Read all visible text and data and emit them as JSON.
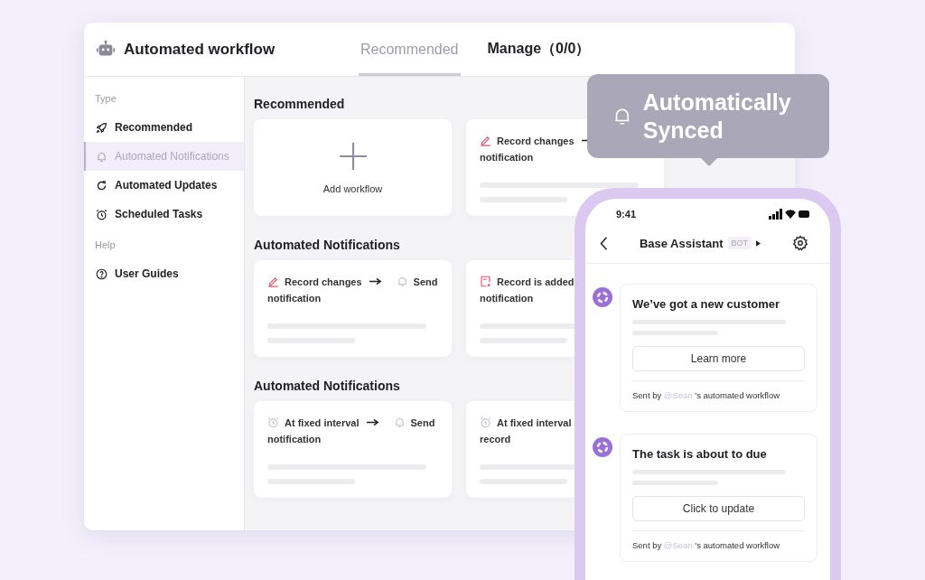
{
  "window": {
    "title": "Automated workflow"
  },
  "tabs": [
    {
      "label": "Recommended",
      "selected": true
    },
    {
      "label": "Manage（0/0）",
      "selected": false
    }
  ],
  "sidebar": {
    "sections": [
      {
        "label": "Type",
        "items": [
          {
            "label": "Recommended",
            "kind": "recommended",
            "selected": false
          },
          {
            "label": "Automated Notifications",
            "kind": "notification",
            "selected": true
          },
          {
            "label": "Automated Updates",
            "kind": "update",
            "selected": false
          },
          {
            "label": "Scheduled Tasks",
            "kind": "schedule",
            "selected": false
          }
        ]
      },
      {
        "label": "Help",
        "items": [
          {
            "label": "User Guides",
            "kind": "guide",
            "selected": false
          }
        ]
      }
    ]
  },
  "sections": [
    {
      "title": "Recommended",
      "cards": [
        {
          "kind": "add",
          "label": "Add workflow"
        },
        {
          "kind": "flow",
          "trigger": {
            "kind": "change",
            "label": "Record changes"
          },
          "arrow": true,
          "line2": "notification"
        }
      ]
    },
    {
      "title": "Automated Notifications",
      "cards": [
        {
          "kind": "flow",
          "trigger": {
            "kind": "change",
            "label": "Record changes"
          },
          "arrow": true,
          "action": "Send",
          "line2": "notification"
        },
        {
          "kind": "flow",
          "trigger": {
            "kind": "added",
            "label": "Record is added"
          },
          "arrow": false,
          "line2": "notification"
        }
      ]
    },
    {
      "title": "Automated Notifications",
      "cards": [
        {
          "kind": "flow",
          "trigger": {
            "kind": "schedule",
            "label": "At fixed interval"
          },
          "arrow": true,
          "action": "Send",
          "line2": "notification"
        },
        {
          "kind": "flow",
          "trigger": {
            "kind": "schedule",
            "label": "At fixed interval"
          },
          "arrow": false,
          "line2": "record"
        }
      ]
    }
  ],
  "tooltip": {
    "text": "Automatically Synced"
  },
  "phone": {
    "time": "9:41",
    "title": "Base Assistant",
    "badge": "BOT",
    "messages": [
      {
        "title": "We’ve got a new customer",
        "button": "Learn more",
        "sent_by": "Sent by",
        "mention": "@Sean",
        "suffix": "'s automated workflow"
      },
      {
        "title": "The task is about to due",
        "button": "Click to update",
        "sent_by": "Sent by",
        "mention": "@Sean",
        "suffix": "'s automated workflow"
      }
    ]
  }
}
